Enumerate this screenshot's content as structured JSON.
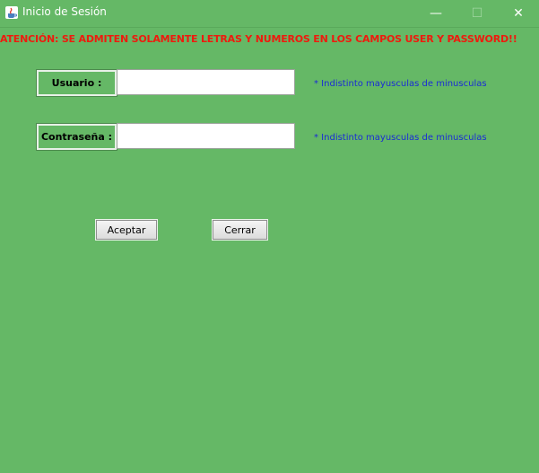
{
  "window": {
    "title": "Inicio de Sesión",
    "minimize_glyph": "—",
    "maximize_glyph": "☐",
    "close_glyph": "✕"
  },
  "warning": "ATENCIÓN: SE ADMITEN SOLAMENTE LETRAS Y NUMEROS EN LOS CAMPOS USER Y PASSWORD!!",
  "form": {
    "user_label": "Usuario :",
    "user_value": "",
    "user_hint": "* Indistinto mayusculas de minusculas",
    "password_label": "Contraseña :",
    "password_value": "",
    "password_hint": "* Indistinto mayusculas de minusculas"
  },
  "buttons": {
    "accept": "Aceptar",
    "close": "Cerrar"
  },
  "colors": {
    "background": "#65b866",
    "warning_text": "#ee1b0e",
    "hint_text": "#1a2bd6"
  },
  "icons": {
    "app": "java-cup-icon"
  }
}
